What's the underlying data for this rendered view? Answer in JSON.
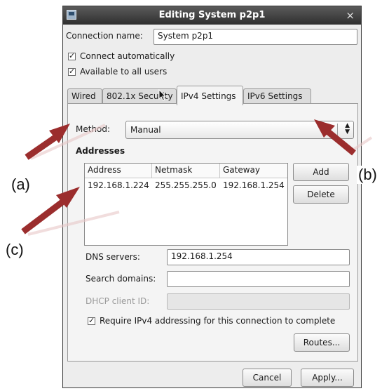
{
  "window": {
    "title": "Editing System p2p1",
    "close_glyph": "×"
  },
  "connection_name": {
    "label": "Connection name:",
    "value": "System p2p1"
  },
  "checkboxes": {
    "connect_automatically": "Connect automatically",
    "available_to_all_users": "Available to all users"
  },
  "tabs": [
    {
      "label": "Wired"
    },
    {
      "label": "802.1x Security"
    },
    {
      "label": "IPv4 Settings",
      "active": true
    },
    {
      "label": "IPv6 Settings"
    }
  ],
  "ipv4": {
    "method_label": "Method:",
    "method_value": "Manual",
    "addresses_heading": "Addresses",
    "table": {
      "columns": [
        "Address",
        "Netmask",
        "Gateway"
      ],
      "rows": [
        [
          "192.168.1.224",
          "255.255.255.0",
          "192.168.1.254"
        ]
      ]
    },
    "add_button": "Add",
    "delete_button": "Delete",
    "dns_label": "DNS servers:",
    "dns_value": "192.168.1.254",
    "search_label": "Search domains:",
    "search_value": "",
    "dhcp_label": "DHCP client ID:",
    "dhcp_value": "",
    "require_ipv4": "Require IPv4 addressing for this connection to complete",
    "routes_button": "Routes..."
  },
  "footer": {
    "cancel_button": "Cancel",
    "apply_button": "Apply..."
  },
  "annotations": {
    "a": "(a)",
    "b": "(b)",
    "c": "(c)",
    "arrow_color": "#9b2d2d"
  }
}
